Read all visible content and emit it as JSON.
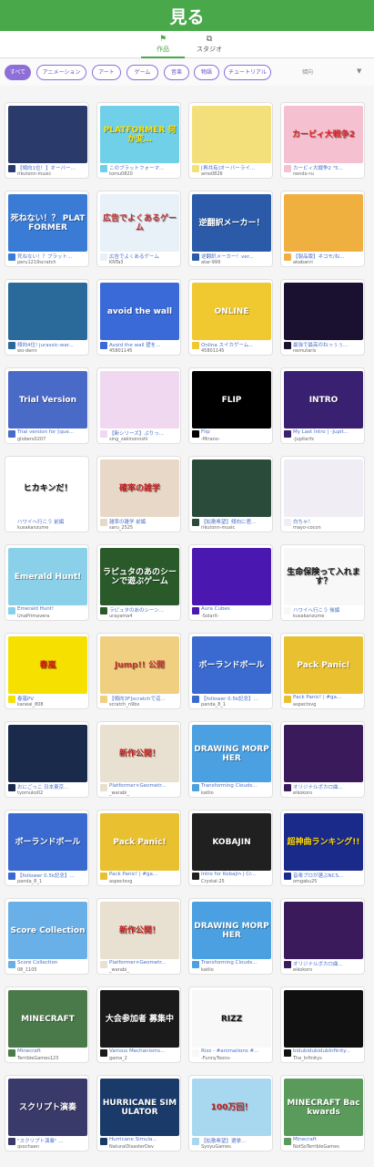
{
  "header": {
    "title": "見る"
  },
  "tabs": [
    {
      "icon": "⚑",
      "label": "作品",
      "active": true
    },
    {
      "icon": "⧉",
      "label": "スタジオ",
      "active": false
    }
  ],
  "filters": [
    {
      "label": "すべて",
      "active": true
    },
    {
      "label": "アニメーション"
    },
    {
      "label": "アート"
    },
    {
      "label": "ゲーム"
    },
    {
      "label": "音楽"
    },
    {
      "label": "物語"
    },
    {
      "label": "チュートリアル"
    }
  ],
  "sort": {
    "label": "傾向",
    "arrow": "▼"
  },
  "colors": {
    "header": "#49a84a",
    "chip": "#8e6fd8",
    "link": "#4a70c9"
  },
  "projects": [
    {
      "title": "【傾向1位！】オーバー...",
      "user": "rikutonn-music",
      "thumb": "#2a3a6a",
      "thumb_text": "",
      "fg": "#fff"
    },
    {
      "title": "このプラットフォーマ...",
      "user": "tomu0820",
      "thumb": "#6fd0e8",
      "thumb_text": "PLATFORMER 何か変…",
      "fg": "#ffe000"
    },
    {
      "title": "[再共有]オーバーライ...",
      "user": "amo0826",
      "thumb": "#f4e07a",
      "thumb_text": "",
      "fg": "#333"
    },
    {
      "title": "カービィ大戦争2 \"5...",
      "user": "nendo-ru",
      "thumb": "#f5c0d0",
      "thumb_text": "カービィ大戦争2",
      "fg": "#e02020"
    },
    {
      "title": "死ねない！？プラット...",
      "user": "peru1219scratch",
      "thumb": "#3a7bd5",
      "thumb_text": "死ねない！？ PLATFORMER",
      "fg": "#fff"
    },
    {
      "title": "広告でよくあるゲーム",
      "user": "KNTa3",
      "thumb": "#e8f0f8",
      "thumb_text": "広告でよくあるゲーム",
      "fg": "#c03030"
    },
    {
      "title": "逆翻訳メーカー！ver...",
      "user": "atar-999",
      "thumb": "#2a5aa8",
      "thumb_text": "逆翻訳メーカー！",
      "fg": "#fff"
    },
    {
      "title": "【製品版】ネコモ/ね...",
      "user": "akabanri",
      "thumb": "#f0b040",
      "thumb_text": "",
      "fg": "#fff"
    },
    {
      "title": "傾向4位! jurassic-war...",
      "user": "wo-denn",
      "thumb": "#2a6a9a",
      "thumb_text": "",
      "fg": "#fff"
    },
    {
      "title": "Avoid the wall 壁を...",
      "user": "45801145",
      "thumb": "#3a6ad8",
      "thumb_text": "avoid the wall",
      "fg": "#fff"
    },
    {
      "title": "Onlina スイカゲーム...",
      "user": "45801145",
      "thumb": "#f0c830",
      "thumb_text": "ONLINE",
      "fg": "#fff"
    },
    {
      "title": "最強で最高のねっぅぅ...",
      "user": "nemutaris",
      "thumb": "#1a1030",
      "thumb_text": "",
      "fg": "#fff"
    },
    {
      "title": "Trial version for [que...",
      "user": "globers0207",
      "thumb": "#4a6ac8",
      "thumb_text": "Trial Version",
      "fg": "#fff"
    },
    {
      "title": "【新シリーズ】ぷりっ...",
      "user": "sing_zakinonnshi",
      "thumb": "#f0d8f0",
      "thumb_text": "",
      "fg": "#804080"
    },
    {
      "title": "Flip",
      "user": "-Mirano-",
      "thumb": "#000",
      "thumb_text": "FLIP",
      "fg": "#fff"
    },
    {
      "title": "My Last Intro | -Jupit...",
      "user": "-Jupiterfx",
      "thumb": "#3a2070",
      "thumb_text": "INTRO",
      "fg": "#fff"
    },
    {
      "title": "ハワイへ行こう 前編",
      "user": "kusakanzume",
      "thumb": "#fff",
      "thumb_text": "ヒカキンだ！",
      "fg": "#111"
    },
    {
      "title": "雑率の雑学 前編",
      "user": "saru_2525",
      "thumb": "#e8d8c8",
      "thumb_text": "確率の雑学",
      "fg": "#c02020"
    },
    {
      "title": "【拡散希望】傾向に君...",
      "user": "rikutonn-music",
      "thumb": "#2a4a3a",
      "thumb_text": "",
      "fg": "#fff"
    },
    {
      "title": "白ちゃ！",
      "user": "mayo-cocon",
      "thumb": "#f0eef4",
      "thumb_text": "",
      "fg": "#333"
    },
    {
      "title": "Emerald Hunt!",
      "user": "UnaPrimavera",
      "thumb": "#8ad0e8",
      "thumb_text": "Emerald Hunt!",
      "fg": "#fff"
    },
    {
      "title": "ラピュタのあのシーン...",
      "user": "urayama4",
      "thumb": "#2a5a2a",
      "thumb_text": "ラピュタのあのシーンで遊ぶゲーム",
      "fg": "#fff"
    },
    {
      "title": "Aura Cubes",
      "user": "-SolarX-",
      "thumb": "#4a18b0",
      "thumb_text": "",
      "fg": "#fff"
    },
    {
      "title": "ハワイへ行こう 後編",
      "user": "kusakanzume",
      "thumb": "#f8f8f8",
      "thumb_text": "生命保険って入れます？",
      "fg": "#111"
    },
    {
      "title": "春嵐PV",
      "user": "kaneai_808",
      "thumb": "#f5e000",
      "thumb_text": "春嵐",
      "fg": "#d01010"
    },
    {
      "title": "【傾向3F]scratchで這...",
      "user": "scratch_n9bx",
      "thumb": "#f0d080",
      "thumb_text": "Jump!! 公開",
      "fg": "#c03030"
    },
    {
      "title": "【follower 0.5k記念】...",
      "user": "panda_8_1",
      "thumb": "#3a6ad0",
      "thumb_text": "ボーランドボール",
      "fg": "#fff"
    },
    {
      "title": "Pack Panic! | #ga...",
      "user": "aspectsvg",
      "thumb": "#e8c030",
      "thumb_text": "Pack Panic!",
      "fg": "#fff"
    },
    {
      "title": "おにごっこ 日本東京...",
      "user": "tyomuko02",
      "thumb": "#1a2a4a",
      "thumb_text": "",
      "fg": "#fff"
    },
    {
      "title": "Platformer×Geometr...",
      "user": "_warabi_",
      "thumb": "#e8e0d0",
      "thumb_text": "新作公開！",
      "fg": "#c02020"
    },
    {
      "title": "Transforming Clouds...",
      "user": "katlio",
      "thumb": "#4aa0e0",
      "thumb_text": "DRAWING MORPHER",
      "fg": "#fff"
    },
    {
      "title": "オリジナルボカロ曲...",
      "user": "eikokoro",
      "thumb": "#3a1a5a",
      "thumb_text": "",
      "fg": "#fff"
    },
    {
      "title": "【follower 0.5k記念】...",
      "user": "panda_8_1",
      "thumb": "#3a6ad0",
      "thumb_text": "ボーランドボール",
      "fg": "#fff"
    },
    {
      "title": "Pack Panic! | #ga...",
      "user": "aspectsvg",
      "thumb": "#e8c030",
      "thumb_text": "Pack Panic!",
      "fg": "#fff"
    },
    {
      "title": "Intro for Kobajin | Cr...",
      "user": "Crystal-25",
      "thumb": "#202020",
      "thumb_text": "KOBAJIN",
      "fg": "#fff"
    },
    {
      "title": "音楽ブロが選ぶNCS...",
      "user": "omgaku25",
      "thumb": "#1a2a8a",
      "thumb_text": "超神曲ランキング!!",
      "fg": "#ffd800"
    },
    {
      "title": "Score Collection",
      "user": "08_1105",
      "thumb": "#6ab0e8",
      "thumb_text": "Score Collection",
      "fg": "#fff"
    },
    {
      "title": "Platformer×Geometr...",
      "user": "_warabi_",
      "thumb": "#e8e0d0",
      "thumb_text": "新作公開！",
      "fg": "#c02020"
    },
    {
      "title": "Transforming Clouds...",
      "user": "katlio",
      "thumb": "#4aa0e0",
      "thumb_text": "DRAWING MORPHER",
      "fg": "#fff"
    },
    {
      "title": "オリジナルボカロ曲...",
      "user": "eikokoro",
      "thumb": "#3a1a5a",
      "thumb_text": "",
      "fg": "#fff"
    },
    {
      "title": "Minecraft",
      "user": "TerribleGames123",
      "thumb": "#4a7a4a",
      "thumb_text": "MINECRAFT",
      "fg": "#fff"
    },
    {
      "title": "Various Mechanisms...",
      "user": "gama_2",
      "thumb": "#1a1a1a",
      "thumb_text": "大会参加者 募集中",
      "fg": "#fff"
    },
    {
      "title": "Rizz - #animations #...",
      "user": "-FunnyToons-",
      "thumb": "#f8f8f8",
      "thumb_text": "RIZZ",
      "fg": "#111"
    },
    {
      "title": "bidubidubidubInfinity...",
      "user": "The_Infinitys",
      "thumb": "#101010",
      "thumb_text": "",
      "fg": "#fff"
    },
    {
      "title": "\"スクリプト演奏\" ...",
      "user": "qsochaen",
      "thumb": "#3a3a6a",
      "thumb_text": "スクリプト演奏",
      "fg": "#fff"
    },
    {
      "title": "Hurricane Simula...",
      "user": "NaturalDisasterDev",
      "thumb": "#1a3a6a",
      "thumb_text": "HURRICANE SIMULATOR",
      "fg": "#fff"
    },
    {
      "title": "【拡散希望】選挙...",
      "user": "SyoyuGames",
      "thumb": "#a8d8f0",
      "thumb_text": "100万回！",
      "fg": "#c02020"
    },
    {
      "title": "Minecraft",
      "user": "NotSoTerribleGames",
      "thumb": "#5a9a5a",
      "thumb_text": "MINECRAFT Backwards",
      "fg": "#fff"
    }
  ]
}
